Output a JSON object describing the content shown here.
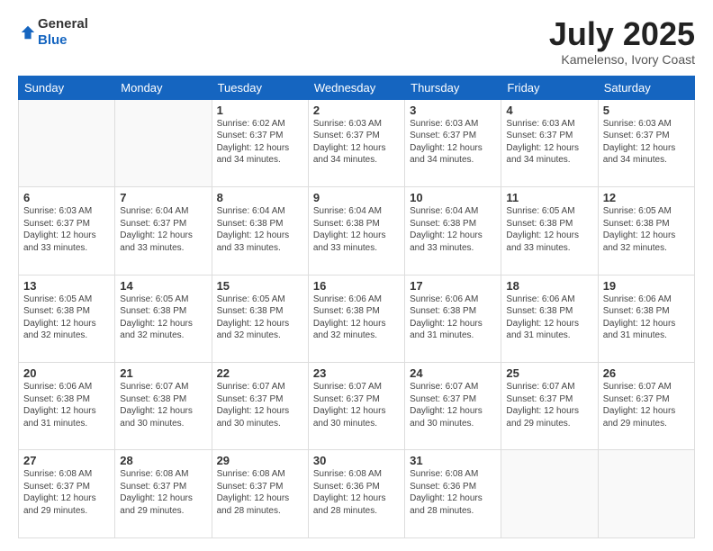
{
  "header": {
    "logo_general": "General",
    "logo_blue": "Blue",
    "title": "July 2025",
    "subtitle": "Kamelenso, Ivory Coast"
  },
  "weekdays": [
    "Sunday",
    "Monday",
    "Tuesday",
    "Wednesday",
    "Thursday",
    "Friday",
    "Saturday"
  ],
  "weeks": [
    [
      {
        "day": "",
        "sunrise": "",
        "sunset": "",
        "daylight": ""
      },
      {
        "day": "",
        "sunrise": "",
        "sunset": "",
        "daylight": ""
      },
      {
        "day": "1",
        "sunrise": "Sunrise: 6:02 AM",
        "sunset": "Sunset: 6:37 PM",
        "daylight": "Daylight: 12 hours and 34 minutes."
      },
      {
        "day": "2",
        "sunrise": "Sunrise: 6:03 AM",
        "sunset": "Sunset: 6:37 PM",
        "daylight": "Daylight: 12 hours and 34 minutes."
      },
      {
        "day": "3",
        "sunrise": "Sunrise: 6:03 AM",
        "sunset": "Sunset: 6:37 PM",
        "daylight": "Daylight: 12 hours and 34 minutes."
      },
      {
        "day": "4",
        "sunrise": "Sunrise: 6:03 AM",
        "sunset": "Sunset: 6:37 PM",
        "daylight": "Daylight: 12 hours and 34 minutes."
      },
      {
        "day": "5",
        "sunrise": "Sunrise: 6:03 AM",
        "sunset": "Sunset: 6:37 PM",
        "daylight": "Daylight: 12 hours and 34 minutes."
      }
    ],
    [
      {
        "day": "6",
        "sunrise": "Sunrise: 6:03 AM",
        "sunset": "Sunset: 6:37 PM",
        "daylight": "Daylight: 12 hours and 33 minutes."
      },
      {
        "day": "7",
        "sunrise": "Sunrise: 6:04 AM",
        "sunset": "Sunset: 6:37 PM",
        "daylight": "Daylight: 12 hours and 33 minutes."
      },
      {
        "day": "8",
        "sunrise": "Sunrise: 6:04 AM",
        "sunset": "Sunset: 6:38 PM",
        "daylight": "Daylight: 12 hours and 33 minutes."
      },
      {
        "day": "9",
        "sunrise": "Sunrise: 6:04 AM",
        "sunset": "Sunset: 6:38 PM",
        "daylight": "Daylight: 12 hours and 33 minutes."
      },
      {
        "day": "10",
        "sunrise": "Sunrise: 6:04 AM",
        "sunset": "Sunset: 6:38 PM",
        "daylight": "Daylight: 12 hours and 33 minutes."
      },
      {
        "day": "11",
        "sunrise": "Sunrise: 6:05 AM",
        "sunset": "Sunset: 6:38 PM",
        "daylight": "Daylight: 12 hours and 33 minutes."
      },
      {
        "day": "12",
        "sunrise": "Sunrise: 6:05 AM",
        "sunset": "Sunset: 6:38 PM",
        "daylight": "Daylight: 12 hours and 32 minutes."
      }
    ],
    [
      {
        "day": "13",
        "sunrise": "Sunrise: 6:05 AM",
        "sunset": "Sunset: 6:38 PM",
        "daylight": "Daylight: 12 hours and 32 minutes."
      },
      {
        "day": "14",
        "sunrise": "Sunrise: 6:05 AM",
        "sunset": "Sunset: 6:38 PM",
        "daylight": "Daylight: 12 hours and 32 minutes."
      },
      {
        "day": "15",
        "sunrise": "Sunrise: 6:05 AM",
        "sunset": "Sunset: 6:38 PM",
        "daylight": "Daylight: 12 hours and 32 minutes."
      },
      {
        "day": "16",
        "sunrise": "Sunrise: 6:06 AM",
        "sunset": "Sunset: 6:38 PM",
        "daylight": "Daylight: 12 hours and 32 minutes."
      },
      {
        "day": "17",
        "sunrise": "Sunrise: 6:06 AM",
        "sunset": "Sunset: 6:38 PM",
        "daylight": "Daylight: 12 hours and 31 minutes."
      },
      {
        "day": "18",
        "sunrise": "Sunrise: 6:06 AM",
        "sunset": "Sunset: 6:38 PM",
        "daylight": "Daylight: 12 hours and 31 minutes."
      },
      {
        "day": "19",
        "sunrise": "Sunrise: 6:06 AM",
        "sunset": "Sunset: 6:38 PM",
        "daylight": "Daylight: 12 hours and 31 minutes."
      }
    ],
    [
      {
        "day": "20",
        "sunrise": "Sunrise: 6:06 AM",
        "sunset": "Sunset: 6:38 PM",
        "daylight": "Daylight: 12 hours and 31 minutes."
      },
      {
        "day": "21",
        "sunrise": "Sunrise: 6:07 AM",
        "sunset": "Sunset: 6:38 PM",
        "daylight": "Daylight: 12 hours and 30 minutes."
      },
      {
        "day": "22",
        "sunrise": "Sunrise: 6:07 AM",
        "sunset": "Sunset: 6:37 PM",
        "daylight": "Daylight: 12 hours and 30 minutes."
      },
      {
        "day": "23",
        "sunrise": "Sunrise: 6:07 AM",
        "sunset": "Sunset: 6:37 PM",
        "daylight": "Daylight: 12 hours and 30 minutes."
      },
      {
        "day": "24",
        "sunrise": "Sunrise: 6:07 AM",
        "sunset": "Sunset: 6:37 PM",
        "daylight": "Daylight: 12 hours and 30 minutes."
      },
      {
        "day": "25",
        "sunrise": "Sunrise: 6:07 AM",
        "sunset": "Sunset: 6:37 PM",
        "daylight": "Daylight: 12 hours and 29 minutes."
      },
      {
        "day": "26",
        "sunrise": "Sunrise: 6:07 AM",
        "sunset": "Sunset: 6:37 PM",
        "daylight": "Daylight: 12 hours and 29 minutes."
      }
    ],
    [
      {
        "day": "27",
        "sunrise": "Sunrise: 6:08 AM",
        "sunset": "Sunset: 6:37 PM",
        "daylight": "Daylight: 12 hours and 29 minutes."
      },
      {
        "day": "28",
        "sunrise": "Sunrise: 6:08 AM",
        "sunset": "Sunset: 6:37 PM",
        "daylight": "Daylight: 12 hours and 29 minutes."
      },
      {
        "day": "29",
        "sunrise": "Sunrise: 6:08 AM",
        "sunset": "Sunset: 6:37 PM",
        "daylight": "Daylight: 12 hours and 28 minutes."
      },
      {
        "day": "30",
        "sunrise": "Sunrise: 6:08 AM",
        "sunset": "Sunset: 6:36 PM",
        "daylight": "Daylight: 12 hours and 28 minutes."
      },
      {
        "day": "31",
        "sunrise": "Sunrise: 6:08 AM",
        "sunset": "Sunset: 6:36 PM",
        "daylight": "Daylight: 12 hours and 28 minutes."
      },
      {
        "day": "",
        "sunrise": "",
        "sunset": "",
        "daylight": ""
      },
      {
        "day": "",
        "sunrise": "",
        "sunset": "",
        "daylight": ""
      }
    ]
  ]
}
